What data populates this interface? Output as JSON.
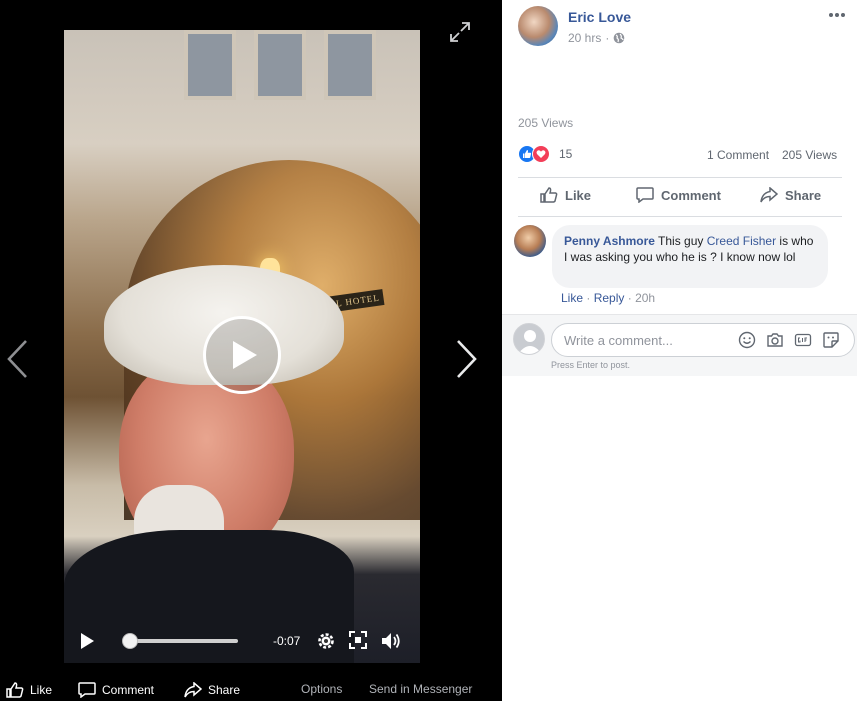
{
  "theater": {
    "time_remaining": "-0:07",
    "progress": 0.05,
    "sign_text": "INTERNATIONAL HOTEL",
    "actions": {
      "like": "Like",
      "comment": "Comment",
      "share": "Share",
      "options": "Options",
      "send_in_messenger": "Send in Messenger"
    },
    "icons": [
      "expand-icon",
      "prev-arrow-icon",
      "next-arrow-icon",
      "play-icon",
      "settings-icon",
      "fullscreen-icon",
      "volume-icon"
    ]
  },
  "post": {
    "author": "Eric Love",
    "time": "20 hrs",
    "privacy_icon": "globe-icon",
    "views_line": "205 Views",
    "reaction_count": "15",
    "comment_count": "1 Comment",
    "views_count": "205 Views",
    "actions": {
      "like": "Like",
      "comment": "Comment",
      "share": "Share"
    }
  },
  "comment": {
    "author": "Penny Ashmore",
    "text_before": "This guy ",
    "mention": "Creed Fisher",
    "text_after": " is who I was asking you who he is ? I know now lol",
    "like": "Like",
    "reply": "Reply",
    "time": "20h"
  },
  "composer": {
    "placeholder": "Write a comment...",
    "hint": "Press Enter to post."
  },
  "colors": {
    "link_blue": "#385898",
    "like_blue": "#1877f2",
    "love_red": "#f33e58",
    "muted_gray": "#90949c"
  }
}
